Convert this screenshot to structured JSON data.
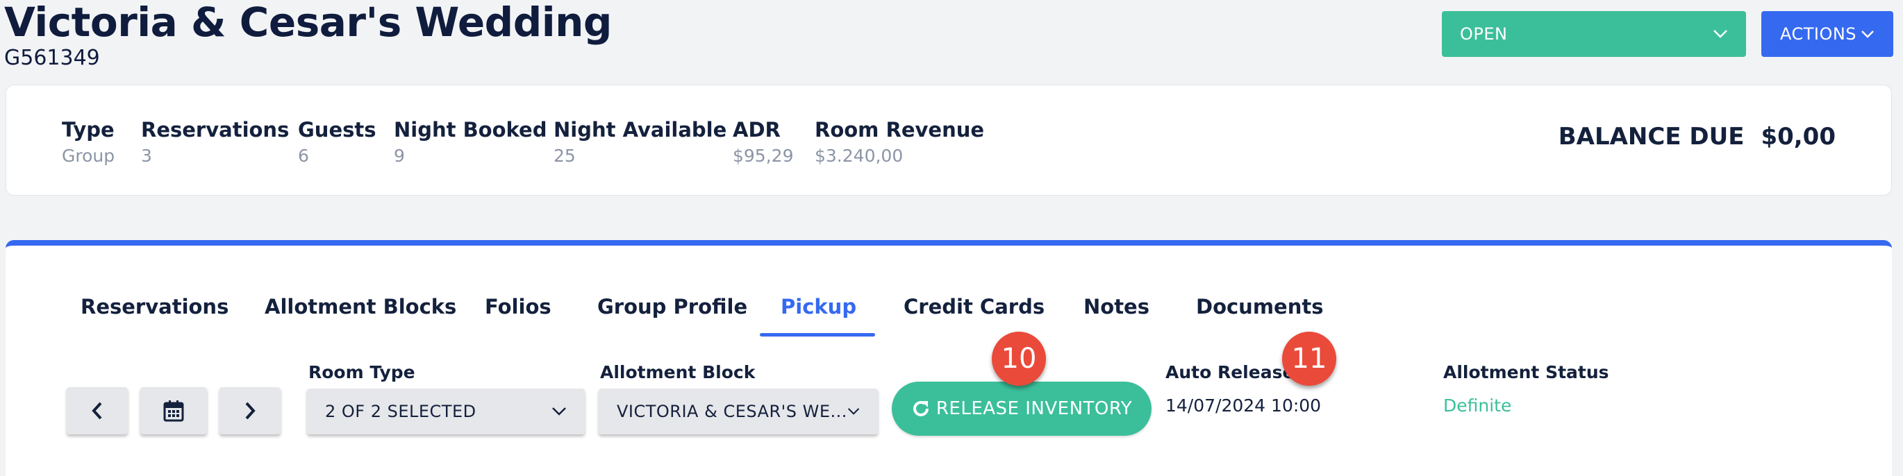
{
  "header": {
    "title": "Victoria & Cesar's Wedding",
    "code": "G561349",
    "status": "OPEN",
    "actions_label": "ACTIONS"
  },
  "summary": {
    "stats": [
      {
        "label": "Type",
        "value": "Group"
      },
      {
        "label": "Reservations",
        "value": "3"
      },
      {
        "label": "Guests",
        "value": "6"
      },
      {
        "label": "Night Booked",
        "value": "9"
      },
      {
        "label": "Night Available",
        "value": "25"
      },
      {
        "label": "ADR",
        "value": "$95,29"
      },
      {
        "label": "Room Revenue",
        "value": "$3.240,00"
      }
    ],
    "balance_label": "BALANCE DUE",
    "balance_value": "$0,00"
  },
  "tabs": [
    {
      "label": "Reservations"
    },
    {
      "label": "Allotment Blocks"
    },
    {
      "label": "Folios"
    },
    {
      "label": "Group Profile"
    },
    {
      "label": "Pickup"
    },
    {
      "label": "Credit Cards"
    },
    {
      "label": "Notes"
    },
    {
      "label": "Documents"
    }
  ],
  "active_tab": "Pickup",
  "pickup": {
    "room_type_label": "Room Type",
    "room_type_value": "2 OF 2 SELECTED",
    "allotment_block_label": "Allotment Block",
    "allotment_block_value": "VICTORIA & CESAR'S WE...",
    "release_button": "RELEASE INVENTORY",
    "auto_release_label": "Auto Release",
    "auto_release_value": "14/07/2024 10:00",
    "allotment_status_label": "Allotment Status",
    "allotment_status_value": "Definite"
  },
  "annotations": [
    "10",
    "11"
  ],
  "colors": {
    "primary": "#3569f0",
    "success": "#3bbf9a",
    "badge": "#ea4a3a",
    "text": "#14213d",
    "muted": "#8c95a6"
  }
}
